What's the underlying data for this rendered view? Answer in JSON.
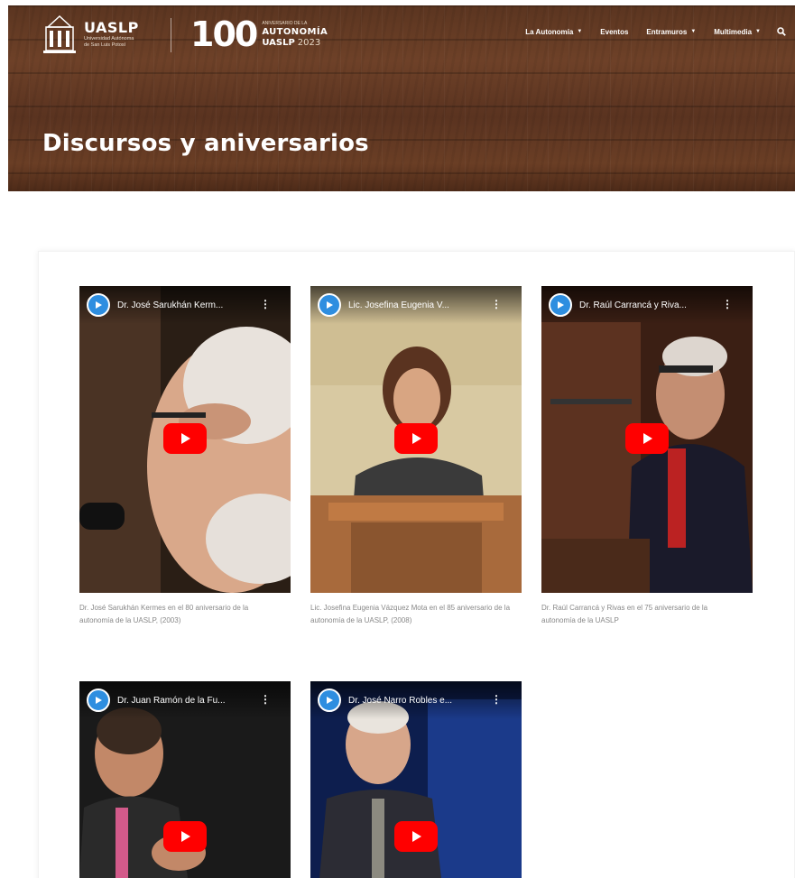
{
  "header": {
    "logo_name": "UASLP",
    "logo_subtitle": "Universidad Autónoma de San Luis Potosí",
    "centenary_number": "100",
    "centenary_line1": "ANIVERSARIO DE LA",
    "centenary_line2": "AUTONOMÍA",
    "centenary_line3": "UASLP",
    "centenary_year": "2023"
  },
  "nav": {
    "items": [
      {
        "label": "La Autonomía",
        "has_dropdown": true
      },
      {
        "label": "Eventos",
        "has_dropdown": false
      },
      {
        "label": "Entramuros",
        "has_dropdown": true
      },
      {
        "label": "Multimedia",
        "has_dropdown": true
      }
    ],
    "search_icon": "search-icon"
  },
  "page": {
    "title": "Discursos y aniversarios"
  },
  "videos": [
    {
      "title": "Dr. José Sarukhán Kerm...",
      "caption": "Dr. José Sarukhán Kermes en el 80 aniversario de la autonomía de la UASLP, (2003)"
    },
    {
      "title": "Lic. Josefina Eugenia V...",
      "caption": "Lic. Josefina Eugenia Vázquez Mota en el 85 aniversario de la autonomía de la UASLP, (2008)"
    },
    {
      "title": "Dr. Raúl Carrancá y Riva...",
      "caption": "Dr. Raúl Carrancá y Rivas en el 75 aniversario de la autonomía de la UASLP"
    },
    {
      "title": "Dr. Juan Ramón de la Fu...",
      "caption": ""
    },
    {
      "title": "Dr. José Narro Robles e...",
      "caption": ""
    }
  ],
  "colors": {
    "play_button": "#ff0000",
    "channel_avatar": "#2e8ee0",
    "hero_wood": "#5b3520"
  }
}
